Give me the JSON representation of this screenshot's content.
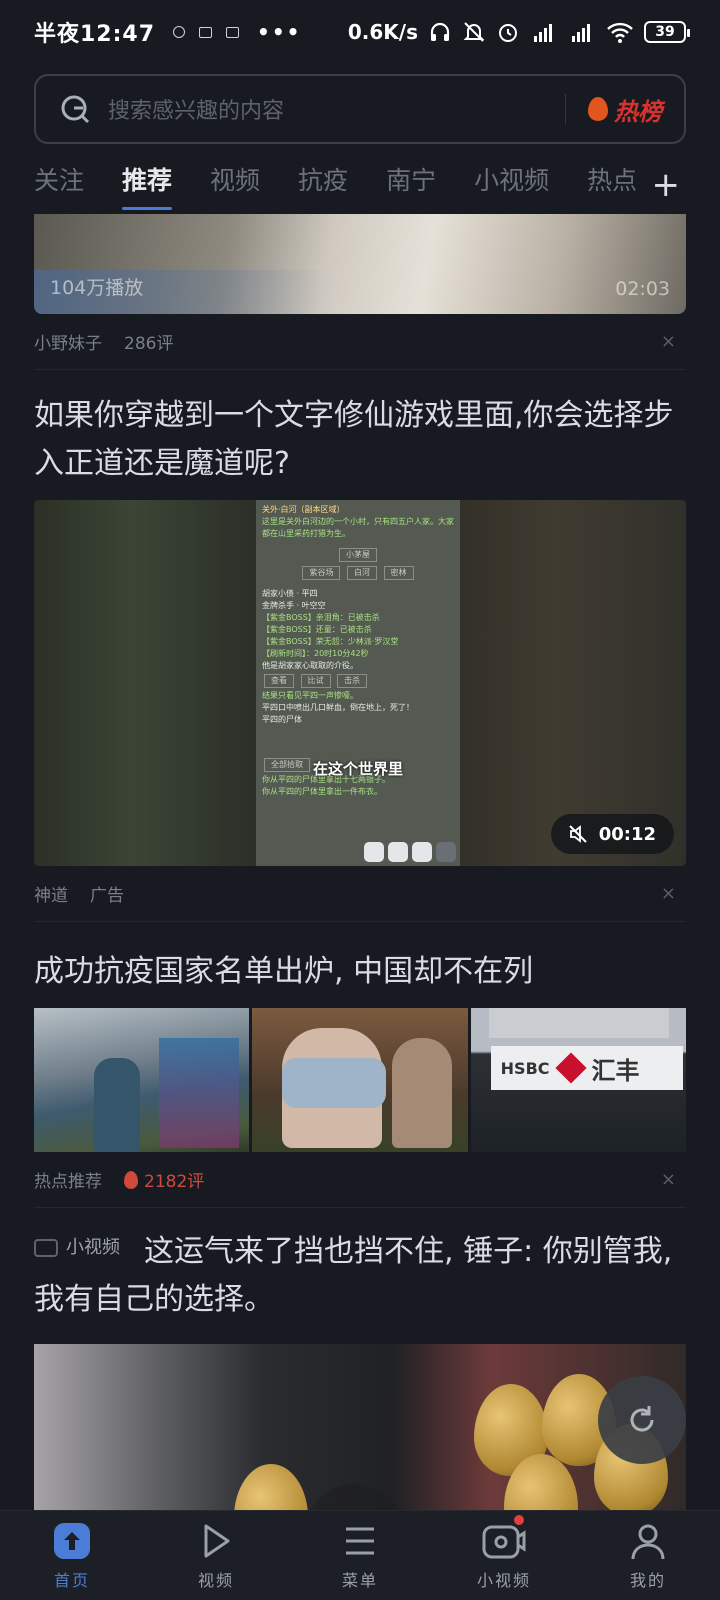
{
  "status": {
    "time": "半夜12:47",
    "dots": "•••",
    "speed": "0.6K/s",
    "battery": "39"
  },
  "search": {
    "placeholder": "搜索感兴趣的内容",
    "hot_label": "热榜"
  },
  "tabs": [
    "关注",
    "推荐",
    "视频",
    "抗疫",
    "南宁",
    "小视频",
    "热点"
  ],
  "active_tab": "推荐",
  "add_tab": "+",
  "feed": {
    "item1": {
      "views": "104万播放",
      "duration": "02:03",
      "source": "小野妹子",
      "comments": "286评",
      "close": "×"
    },
    "item2": {
      "title": "如果你穿越到一个文字修仙游戏里面,你会选择步入正道还是魔道呢?",
      "duration": "00:12",
      "caption": "在这个世界里",
      "source": "神道",
      "tag": "广告",
      "close": "×",
      "game": {
        "header": "关外·白河（副本区域）",
        "desc": "这里是关外白河边的一个小村，只有四五户人家。大家都在山里采药打猎为生。",
        "room": "小茅屋",
        "exits": [
          "紫谷场",
          "白河",
          "密林"
        ],
        "npc1": "胡家小债 · 平四",
        "npc2": "金牌杀手 · 叶空空",
        "boss1": "【紫金BOSS】亲泪角：已被击杀",
        "boss2": "【紫金BOSS】还童：已被击杀",
        "boss3": "【紫金BOSS】荣无怨：少林派·罗汉堂",
        "refresh": "【刷新时间】：20时10分42秒",
        "hint": "他是胡家家心取取的介役。",
        "actions": [
          "查看",
          "比试",
          "击杀"
        ],
        "log1": "结果只看见平四一声惨嚎。",
        "log2": "平四口中喷出几口鲜血，倒在地上，死了！",
        "log3": "平四的尸体",
        "pickup": "全部拾取",
        "log4": "你从平四的尸体里拿出十七两银子。",
        "log5": "你从平四的尸体里拿出一件布衣。"
      }
    },
    "item3": {
      "title": "成功抗疫国家名单出炉, 中国却不在列",
      "source": "热点推荐",
      "comments": "2182评",
      "close": "×",
      "sign_text": "HSBC",
      "sign_cn": "汇丰"
    },
    "item4": {
      "tag": "小视频",
      "title": "这运气来了挡也挡不住, 锤子: 你别管我, 我有自己的选择。"
    }
  },
  "bottom_nav": [
    {
      "label": "首页",
      "icon": "home-upload-icon",
      "active": true
    },
    {
      "label": "视频",
      "icon": "play-icon",
      "active": false
    },
    {
      "label": "菜单",
      "icon": "menu-icon",
      "active": false
    },
    {
      "label": "小视频",
      "icon": "camera-icon",
      "active": false,
      "badge": true
    },
    {
      "label": "我的",
      "icon": "user-icon",
      "active": false
    }
  ],
  "colors": {
    "accent": "#4b7cd6",
    "hot": "#d8322e",
    "background": "#171a20"
  }
}
